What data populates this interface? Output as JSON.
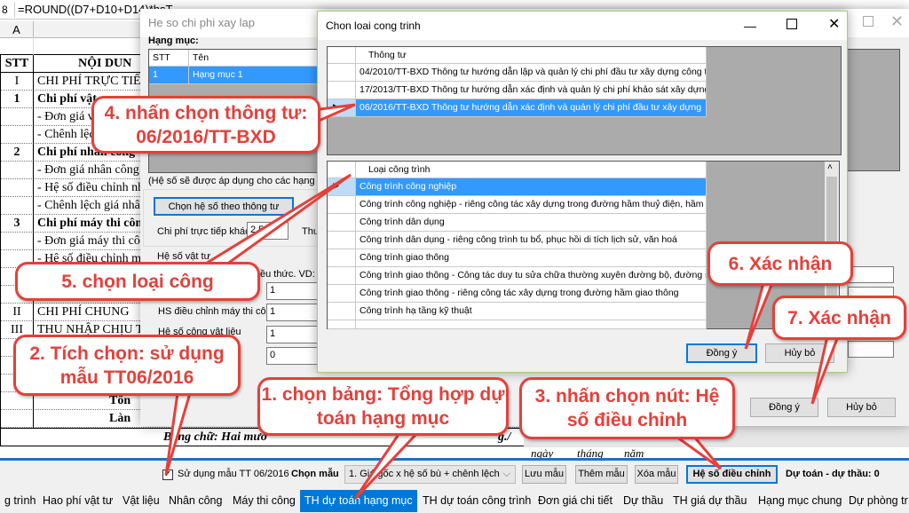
{
  "formula_bar": {
    "cell_ref": "8",
    "formula": "=ROUND((D7+D10+D14)*hsT"
  },
  "sheet": {
    "col_a": "A",
    "rows": [
      {
        "stt": "",
        "text": "",
        "bold": false
      },
      {
        "stt": "STT",
        "text": "NỘI DUN",
        "bold": true,
        "center": true
      },
      {
        "stt": "I",
        "text": "CHI PHÍ TRỰC TIẾ",
        "bold": false
      },
      {
        "stt": "1",
        "text": "Chi phí vật",
        "bold": true
      },
      {
        "stt": "",
        "text": "- Đơn giá v",
        "bold": false
      },
      {
        "stt": "",
        "text": "- Chênh lệc",
        "bold": false
      },
      {
        "stt": "2",
        "text": "Chi phí nhân công",
        "bold": true
      },
      {
        "stt": "",
        "text": "- Đơn giá nhân công",
        "bold": false
      },
      {
        "stt": "",
        "text": "- Hệ số điều chỉnh nh",
        "bold": false
      },
      {
        "stt": "",
        "text": "- Chênh lệch giá nhân",
        "bold": false
      },
      {
        "stt": "3",
        "text": "Chi phí máy thi côn",
        "bold": true
      },
      {
        "stt": "",
        "text": "- Đơn giá máy thi côn",
        "bold": false
      },
      {
        "stt": "",
        "text": "- Hệ số điều chỉnh m",
        "bold": false
      },
      {
        "stt": "",
        "text": "",
        "bold": false
      },
      {
        "stt": "",
        "text": "",
        "bold": false
      },
      {
        "stt": "II",
        "text": "CHI PHÍ CHUNG",
        "bold": false
      },
      {
        "stt": "III",
        "text": "THU NHẬP CHỊU T",
        "bold": false
      },
      {
        "stt": "",
        "text": "",
        "bold": false
      },
      {
        "stt": "I",
        "text": "",
        "bold": false
      },
      {
        "stt": "",
        "text": "",
        "bold": false
      },
      {
        "stt": "",
        "text": "Tổn",
        "bold": true,
        "right": true
      },
      {
        "stt": "",
        "text": "Làn",
        "bold": true,
        "right": true
      }
    ],
    "words_label": "Bằng chữ: Hai mươ",
    "words_tail": "g./",
    "date": {
      "day": "ngày",
      "month": "tháng",
      "year": "năm"
    }
  },
  "dialog_heso": {
    "title": "He so chi phi xay lap",
    "hang_muc_label": "Hạng mục:",
    "grid_headers": [
      "STT",
      "Tên"
    ],
    "grid_rows": [
      {
        "stt": "1",
        "ten": "Hạng mục 1"
      }
    ],
    "note": "(Hệ số sẽ được áp dụng cho các hạng mục",
    "choose_button": "Chọn hệ số theo thông tư",
    "ctk_label": "Chi phí trực tiếp khác",
    "ctk_value": "2,5%",
    "thu_label": "Thu",
    "vattu_group": "Hệ số vật tư",
    "formula_hint": "ều thức. VD: 5,",
    "field1_value": "1",
    "hs_may_label": "HS điều chỉnh máy thi công",
    "hs_may_value": "1",
    "hs_cong_label": "Hệ số công vật liệu",
    "hs_cong_value": "1",
    "field4_value": "0",
    "ok": "Đồng ý",
    "cancel": "Hủy bỏ"
  },
  "dialog_loai": {
    "title": "Chon loai cong trinh",
    "thongtu_header": "Thông tư",
    "thongtu_rows": [
      "04/2010/TT-BXD Thông tư hướng dẫn lập và quản lý chi phí đầu tư xây dựng công trình",
      "17/2013/TT-BXD Thông tư hướng dẫn xác định và quản lý chi phí khảo sát xây dựng",
      "06/2016/TT-BXD Thông tư hướng dẫn xác định và quản lý chi phí đầu tư xây dựng"
    ],
    "thongtu_selected": 2,
    "loai_header": "Loại công trình",
    "loai_rows": [
      "Công trình công nghiệp",
      "Công trình công nghiệp - riêng công tác xây dựng trong đường hầm thuỷ điện, hầm lò",
      "Công trình dân dụng",
      "Công trình dân dụng - riêng công trình tu bổ, phục hồi di tích lịch sử, văn hoá",
      "Công trình giao thông",
      "Công trình giao thông - Công tác duy tu sửa chữa thường xuyên đường bộ, đường sắt, đường",
      "Công trình giao thông - riêng công tác xây dựng trong đường hầm giao thông",
      "Công trình hạ tầng kỹ thuật"
    ],
    "loai_selected": 0,
    "ok": "Đồng ý",
    "cancel": "Hủy bỏ"
  },
  "toolbar": {
    "use_template_label": "Sử dụng mẫu TT 06/2016",
    "use_template_checked": true,
    "choose_template_label": "Chọn mẫu",
    "template_value": "1. Giá gốc x hệ số bù + chênh lệch",
    "save_template": "Lưu mẫu",
    "add_template": "Thêm mẫu",
    "delete_template": "Xóa mẫu",
    "adjust_coef": "Hệ số điều chỉnh",
    "status": "Dự toán - dự thầu: 0"
  },
  "tabs": [
    "g trình",
    "Hao phí vật tư",
    "Vật liệu",
    "Nhân công",
    "Máy thi công",
    "TH dự toán hạng mục",
    "TH dự toán công trình",
    "Đơn giá chi tiết",
    "Dự thầu",
    "TH giá dự thầu",
    "Hạng mục chung",
    "Dự phòng tr"
  ],
  "active_tab": 5,
  "callouts": {
    "c1": "1. chọn bảng: Tổng hợp dự toán hạng mục",
    "c2": "2. Tích chọn: sử dụng mẫu TT06/2016",
    "c3": "3. nhấn chọn nút: Hệ số điều chỉnh",
    "c4": "4. nhấn chọn thông tư: 06/2016/TT-BXD",
    "c5": "5. chọn loại công",
    "c6": "6. Xác nhận",
    "c7": "7. Xác nhận"
  },
  "colors": {
    "accent": "#0078d7",
    "selection": "#3399ff",
    "callout": "#e5403a"
  }
}
